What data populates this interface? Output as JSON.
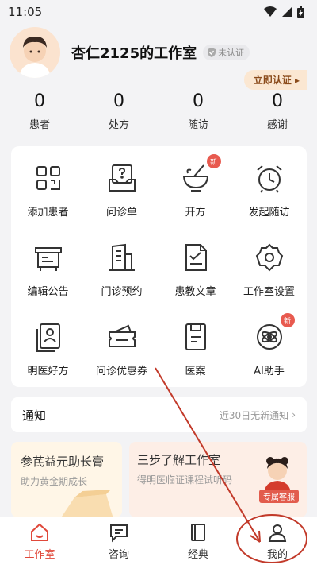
{
  "status_bar": {
    "time": "11:05"
  },
  "profile": {
    "name": "杏仁2125的工作室",
    "badge": "未认证",
    "verify_button": "立即认证"
  },
  "stats": [
    {
      "value": "0",
      "label": "患者"
    },
    {
      "value": "0",
      "label": "处方"
    },
    {
      "value": "0",
      "label": "随访"
    },
    {
      "value": "0",
      "label": "感谢"
    }
  ],
  "grid": [
    {
      "label": "添加患者",
      "icon": "qr-icon"
    },
    {
      "label": "问诊单",
      "icon": "question-doc-icon"
    },
    {
      "label": "开方",
      "icon": "mortar-icon",
      "badge": "新"
    },
    {
      "label": "发起随访",
      "icon": "alarm-clock-icon"
    },
    {
      "label": "编辑公告",
      "icon": "board-icon"
    },
    {
      "label": "门诊预约",
      "icon": "building-icon"
    },
    {
      "label": "患教文章",
      "icon": "document-check-icon"
    },
    {
      "label": "工作室设置",
      "icon": "gear-icon"
    },
    {
      "label": "明医好方",
      "icon": "doctor-doc-icon"
    },
    {
      "label": "问诊优惠券",
      "icon": "coupon-icon"
    },
    {
      "label": "医案",
      "icon": "folder-icon"
    },
    {
      "label": "AI助手",
      "icon": "ai-icon",
      "badge": "新"
    }
  ],
  "notice": {
    "title": "通知",
    "right_text": "近30日无新通知"
  },
  "promos": {
    "left": {
      "title": "参芪益元助长膏",
      "subtitle": "助力黄金期成长"
    },
    "right": {
      "title": "三步了解工作室",
      "subtitle": "得明医临证课程试听码",
      "service_label": "专属客服"
    }
  },
  "tabs": [
    {
      "label": "工作室",
      "icon": "home-icon"
    },
    {
      "label": "咨询",
      "icon": "chat-icon"
    },
    {
      "label": "经典",
      "icon": "book-icon"
    },
    {
      "label": "我的",
      "icon": "user-icon"
    }
  ],
  "colors": {
    "accent": "#e0483a",
    "badge": "#e85a4f",
    "verify_bg": "#fbe7d2",
    "annotation": "#c23a2a"
  }
}
